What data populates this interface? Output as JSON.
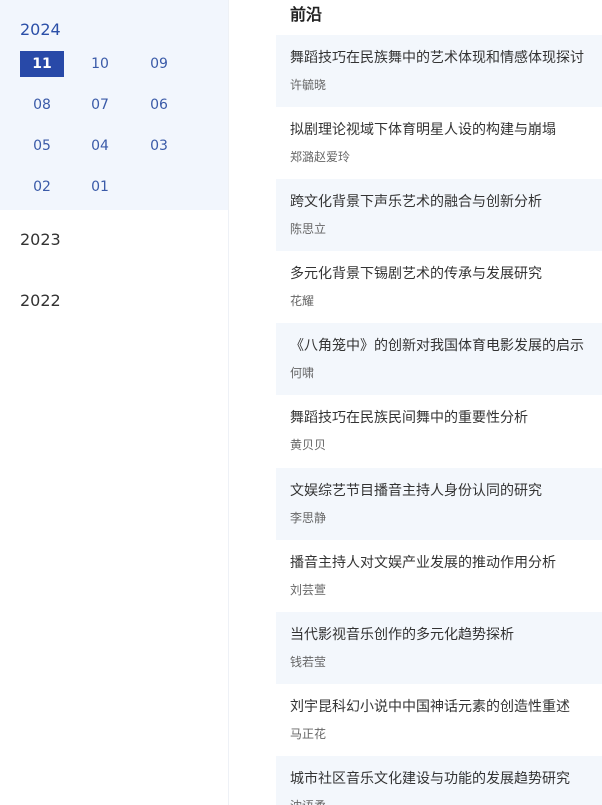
{
  "sidebar": {
    "active_year": "2024",
    "months": [
      "11",
      "10",
      "09",
      "08",
      "07",
      "06",
      "05",
      "04",
      "03",
      "02",
      "01"
    ],
    "active_month": "11",
    "other_years": [
      "2023",
      "2022"
    ]
  },
  "main": {
    "section_title": "前沿",
    "articles": [
      {
        "title": "舞蹈技巧在民族舞中的艺术体现和情感体现探讨",
        "author": "许毓晓"
      },
      {
        "title": "拟剧理论视域下体育明星人设的构建与崩塌",
        "author": "郑潞赵爱玲"
      },
      {
        "title": "跨文化背景下声乐艺术的融合与创新分析",
        "author": "陈思立"
      },
      {
        "title": "多元化背景下锡剧艺术的传承与发展研究",
        "author": "花耀"
      },
      {
        "title": "《八角笼中》的创新对我国体育电影发展的启示",
        "author": "何啸"
      },
      {
        "title": "舞蹈技巧在民族民间舞中的重要性分析",
        "author": "黄贝贝"
      },
      {
        "title": "文娱综艺节目播音主持人身份认同的研究",
        "author": "李思静"
      },
      {
        "title": "播音主持人对文娱产业发展的推动作用分析",
        "author": "刘芸萱"
      },
      {
        "title": "当代影视音乐创作的多元化趋势探析",
        "author": "钱若莹"
      },
      {
        "title": "刘宇昆科幻小说中中国神话元素的创造性重述",
        "author": "马正花"
      },
      {
        "title": "城市社区音乐文化建设与功能的发展趋势研究",
        "author": "沈语柔"
      }
    ]
  }
}
